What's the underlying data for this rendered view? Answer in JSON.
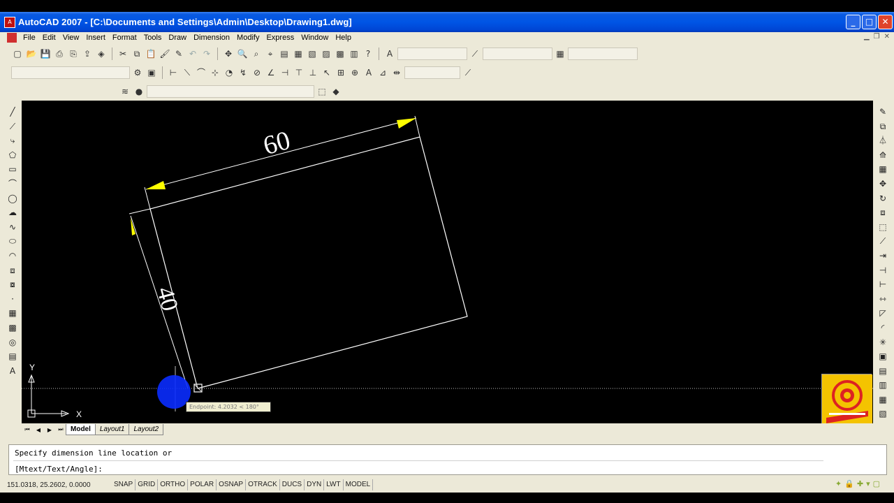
{
  "window": {
    "title": "AutoCAD 2007 - [C:\\Documents and Settings\\Admin\\Desktop\\Drawing1.dwg]",
    "minimize": "_",
    "maximize": "□",
    "close": "✕"
  },
  "menu": {
    "items": [
      "File",
      "Edit",
      "View",
      "Insert",
      "Format",
      "Tools",
      "Draw",
      "Dimension",
      "Modify",
      "Express",
      "Window",
      "Help"
    ]
  },
  "drawing": {
    "dimension_top": "60",
    "dimension_left": "40",
    "ucs_y": "Y",
    "ucs_x": "X",
    "tooltip": "Endpoint: 4.2032 < 180°"
  },
  "tabs": {
    "model": "Model",
    "layout1": "Layout1",
    "layout2": "Layout2"
  },
  "command": {
    "line1": "Specify dimension line location or",
    "line2": "[Mtext/Text/Angle]:"
  },
  "status": {
    "coordinates": "151.0318, 25.2602, 0.0000",
    "buttons": [
      "SNAP",
      "GRID",
      "ORTHO",
      "POLAR",
      "OSNAP",
      "OTRACK",
      "DUCS",
      "DYN",
      "LWT",
      "MODEL"
    ]
  },
  "colors": {
    "titlebar": "#0055E5",
    "canvas": "#000000",
    "arrow": "#FFFF00",
    "cursor_highlight": "#0A2CFF",
    "badge": "#F4C300"
  }
}
